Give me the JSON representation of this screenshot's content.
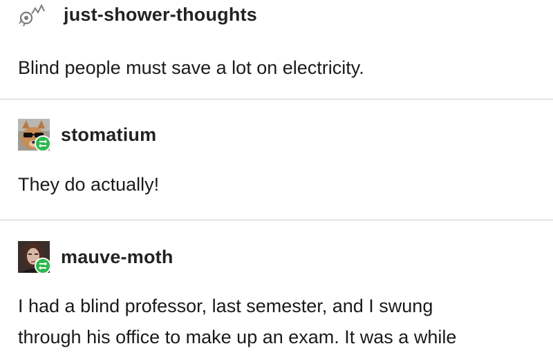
{
  "posts": [
    {
      "username": "just-shower-thoughts",
      "avatar_icon": "shower-thoughts-logo-icon",
      "text": [
        "Blind people must save a lot on electricity."
      ]
    },
    {
      "username": "stomatium",
      "avatar_icon": "dog-sunglasses-avatar",
      "reblog_icon": "reblog-icon",
      "text": [
        "They do actually!"
      ]
    },
    {
      "username": "mauve-moth",
      "avatar_icon": "person-avatar",
      "reblog_icon": "reblog-icon",
      "text": [
        "I had a blind professor, last semester, and I swung",
        "through his office to make up an exam. It was a while"
      ]
    }
  ],
  "colors": {
    "reblog_badge": "#2dba4e",
    "divider": "#cfcfcf",
    "text": "#1a1a1a"
  }
}
